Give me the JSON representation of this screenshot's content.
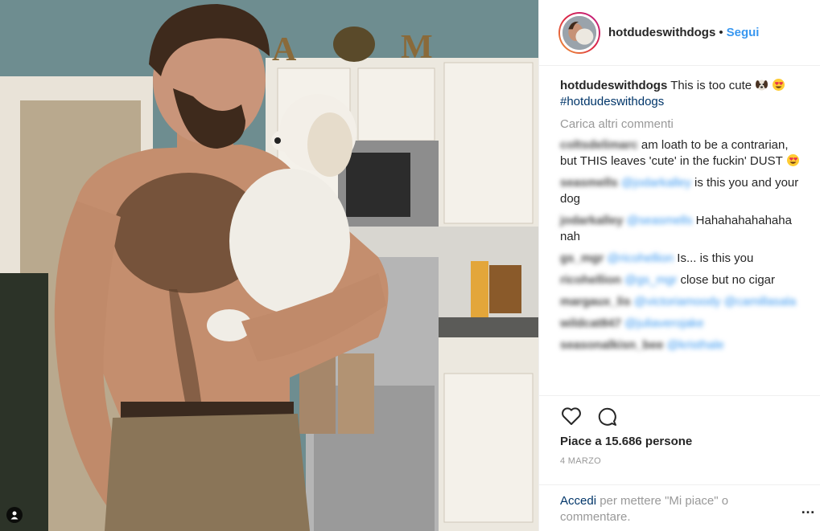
{
  "post": {
    "username": "hotdudeswithdogs",
    "separator": "•",
    "follow_label": "Segui",
    "avatar_icon": "profile-photo",
    "caption_text": "This is too cute",
    "caption_hashtag": "#hotdudeswithdogs",
    "load_more_label": "Carica altri commenti",
    "comments": [
      {
        "user": "coltsdelimarc",
        "mention": "",
        "text": "am loath to be a contrarian, but THIS leaves 'cute' in the fuckin' DUST",
        "emoji_after": true
      },
      {
        "user": "seasmells",
        "mention": "@jodarkalley",
        "text": "is this you and your dog"
      },
      {
        "user": "jodarkalley",
        "mention": "@seasmells",
        "text": "Hahahahahahaha nah"
      },
      {
        "user": "gs_mgr",
        "mention": "@ricohellion",
        "text": "Is... is this you"
      },
      {
        "user": "ricohellion",
        "mention": "@gs_mgr",
        "text": "close but no cigar"
      },
      {
        "user": "margaux_lis",
        "mention": "@victoriamoody @camillasala",
        "text": ""
      },
      {
        "user": "wildcat847",
        "mention": "@juliaverojake",
        "text": ""
      },
      {
        "user": "seasonalkisn_bee",
        "mention": "@kristhale",
        "text": ""
      }
    ],
    "likes_label": "Piace a 15.686 persone",
    "date_label": "4 MARZO",
    "login_link": "Accedi",
    "login_text": "per mettere \"Mi piace\" o commentare.",
    "more_icon": "…",
    "colors": {
      "accent": "#3897f0",
      "link": "#003569",
      "muted": "#999999"
    }
  }
}
